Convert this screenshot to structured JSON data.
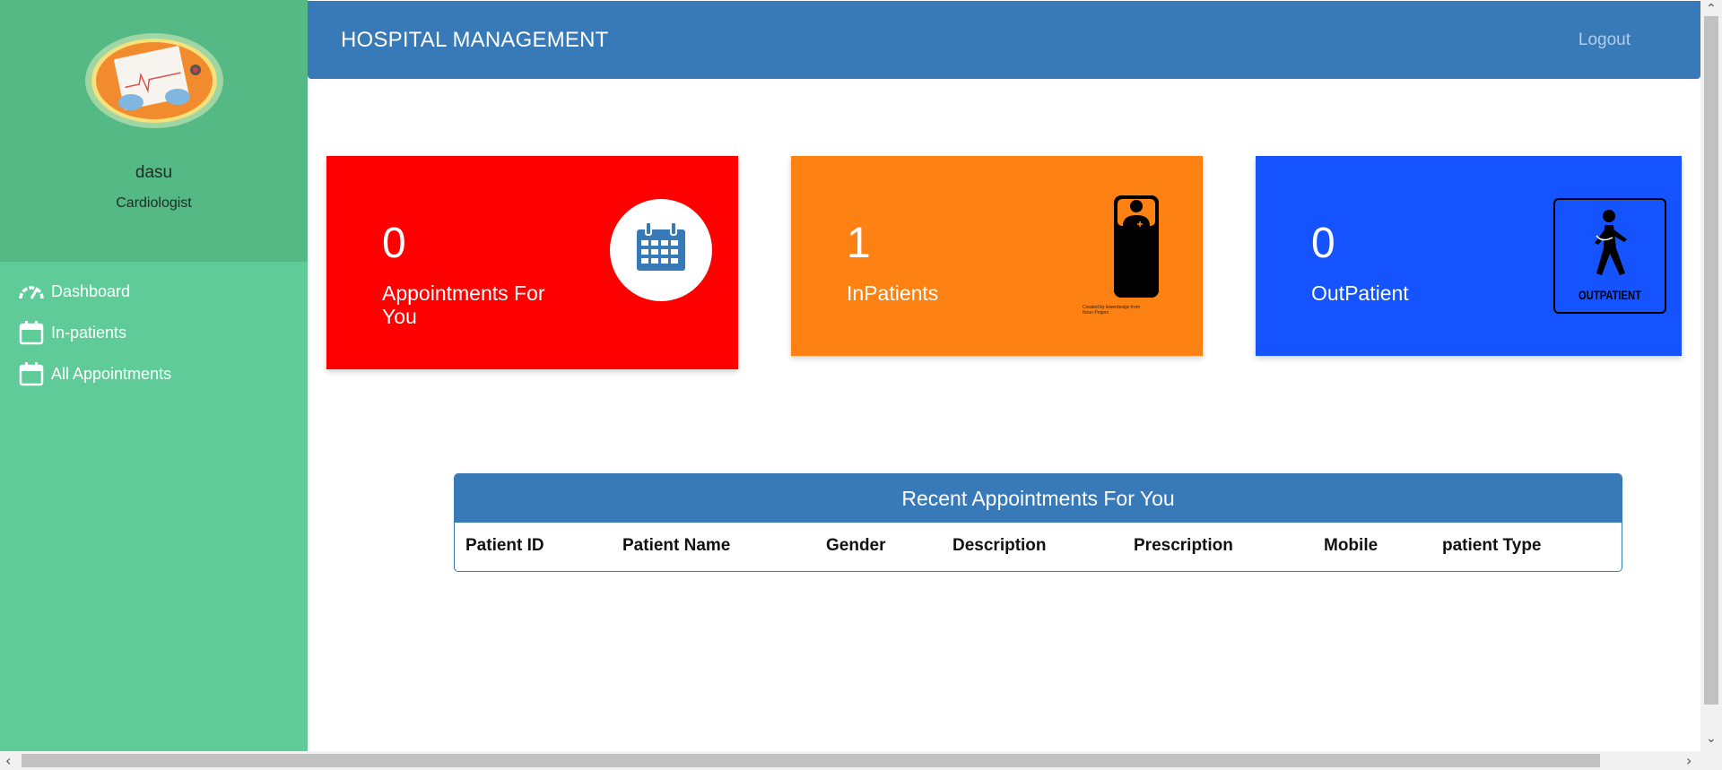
{
  "sidebar": {
    "user_name": "dasu",
    "user_role": "Cardiologist",
    "items": [
      {
        "label": "Dashboard",
        "icon": "speedometer-icon"
      },
      {
        "label": "In-patients",
        "icon": "calendar-icon"
      },
      {
        "label": "All Appointments",
        "icon": "calendar-icon"
      }
    ]
  },
  "header": {
    "title": "HOSPITAL MANAGEMENT",
    "logout_label": "Logout"
  },
  "cards": [
    {
      "count": "0",
      "label": "Appointments For You",
      "color": "#ff0000",
      "icon": "calendar-icon"
    },
    {
      "count": "1",
      "label": "InPatients",
      "color": "#fd8213",
      "icon": "hospital-bed-patient-icon",
      "icon_credit": "Created by lewerdesign from Noun Project"
    },
    {
      "count": "0",
      "label": "OutPatient",
      "color": "#1453fe",
      "icon": "walking-patient-icon",
      "icon_text": "OUTPATIENT"
    }
  ],
  "table": {
    "title": "Recent Appointments For You",
    "columns": [
      "Patient ID",
      "Patient Name",
      "Gender",
      "Description",
      "Prescription",
      "Mobile",
      "patient Type"
    ]
  },
  "colors": {
    "sidebar": "#5ecb98",
    "sidebar_top": "#55b985",
    "header": "#377ab7"
  }
}
